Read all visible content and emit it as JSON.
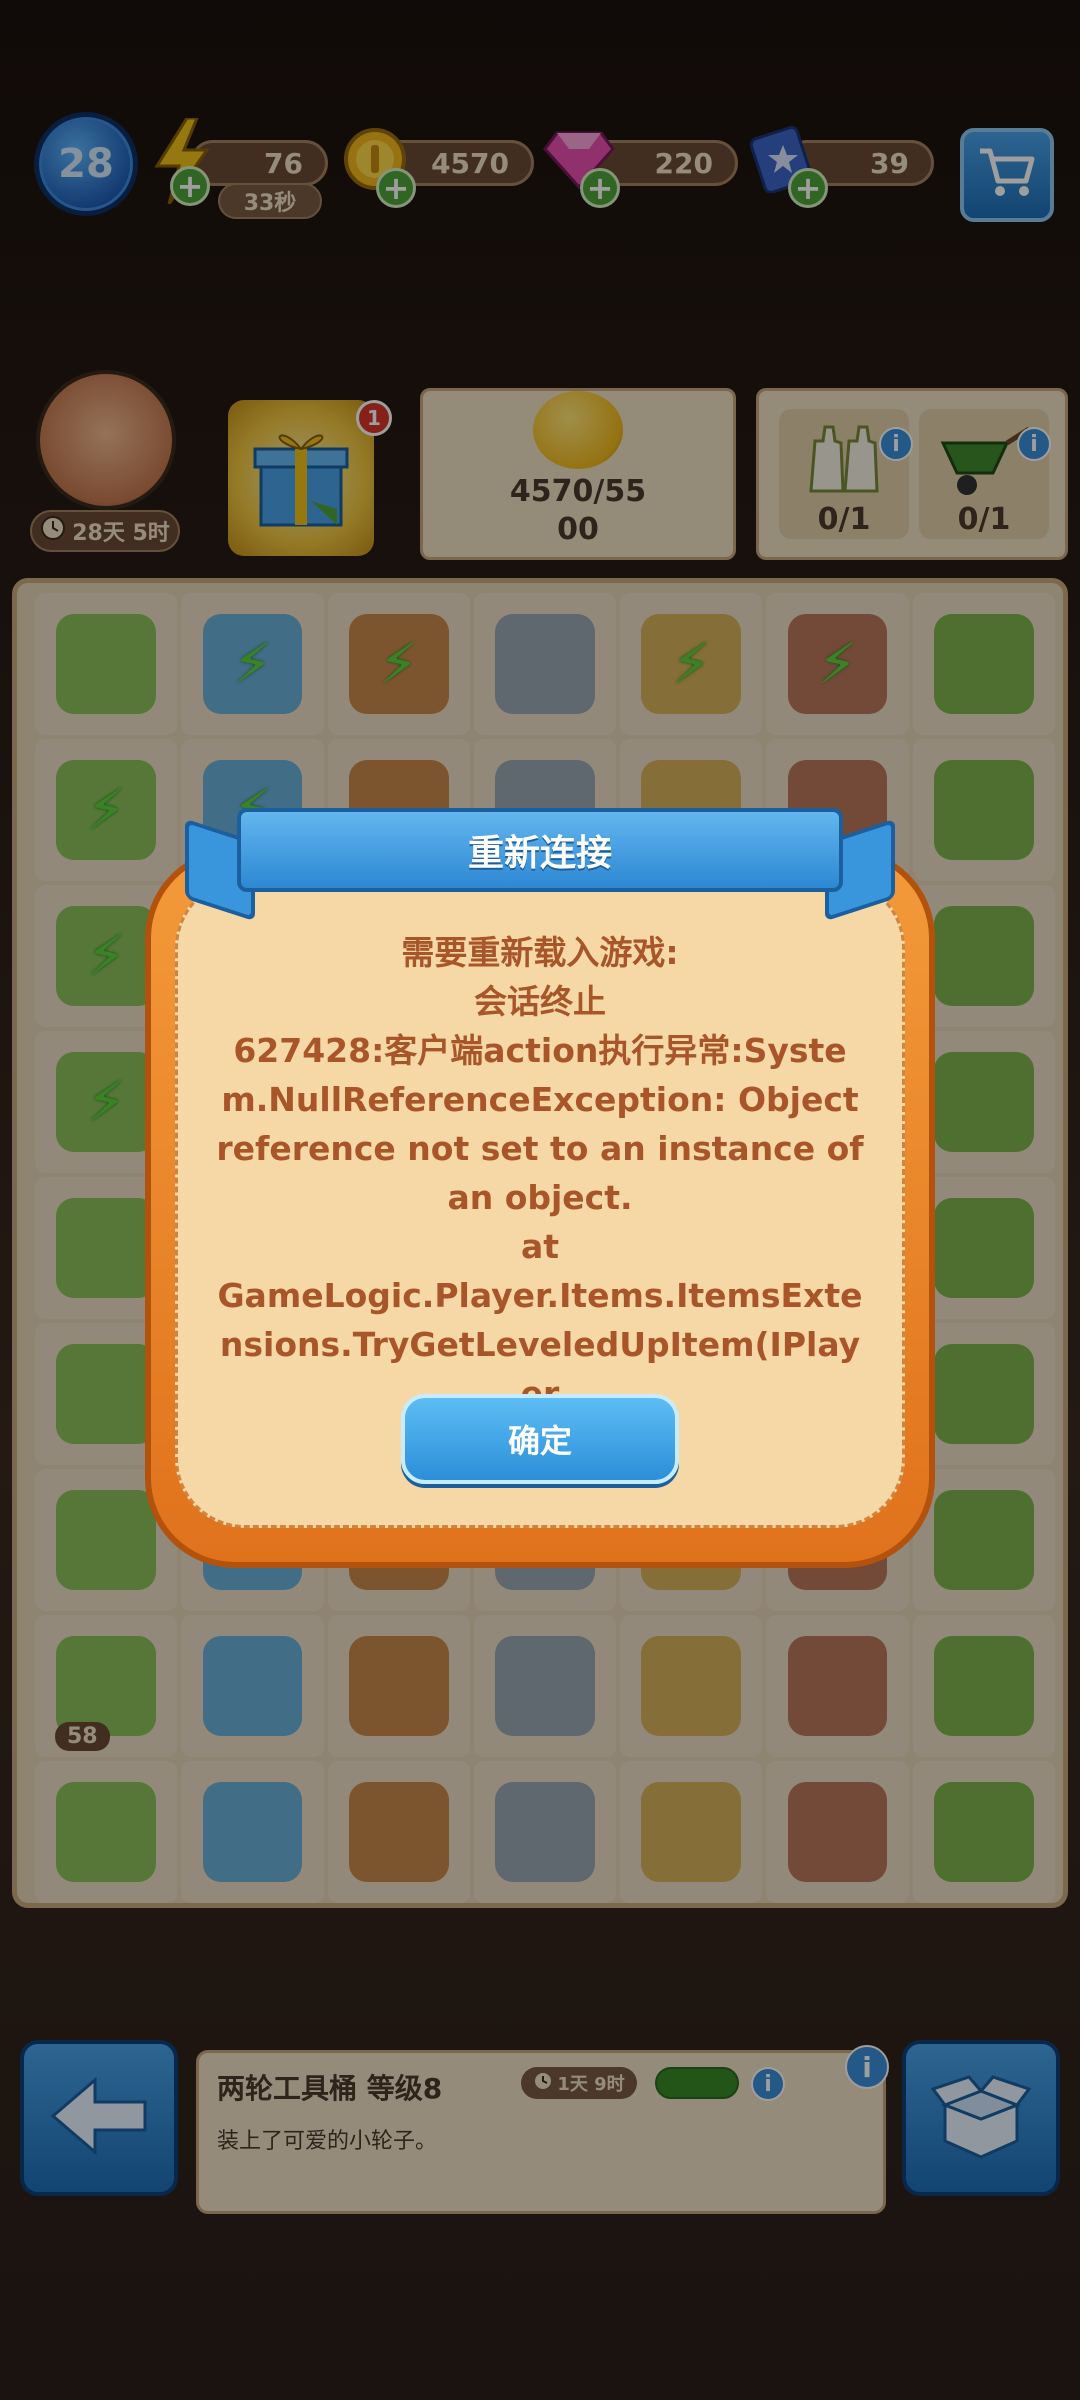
{
  "top_bar": {
    "level": "28",
    "energy": "76",
    "energy_timer": "33秒",
    "coins": "4570",
    "gems": "220",
    "tickets": "39"
  },
  "header": {
    "avatar_timer": "28天 5时",
    "gift_badge": "1",
    "coin_goal": "4570/5500",
    "tool_goals": [
      "0/1",
      "0/1"
    ]
  },
  "board": {
    "counter_badge": "58"
  },
  "info_panel": {
    "title": "两轮工具桶 等级8",
    "time": "1天 9时",
    "description": "装上了可爱的小轮子。"
  },
  "dialog": {
    "title": "重新连接",
    "lines": [
      "需要重新载入游戏:",
      "会话终止",
      "627428:客户端action执行异常:System.NullReferenceException: Object reference not set to an instance of an object.",
      "at",
      "GameLogic.Player.Items.ItemsExtensions.TryGetLeveledUpItem(IPlayer"
    ],
    "confirm_label": "确定"
  },
  "colors": {
    "dialog_orange": "#e0721c",
    "dialog_cream": "#f6d7a6",
    "dialog_text": "#a9552a",
    "ribbon_blue": "#2d88d3",
    "button_blue": "#2b8fd9"
  }
}
